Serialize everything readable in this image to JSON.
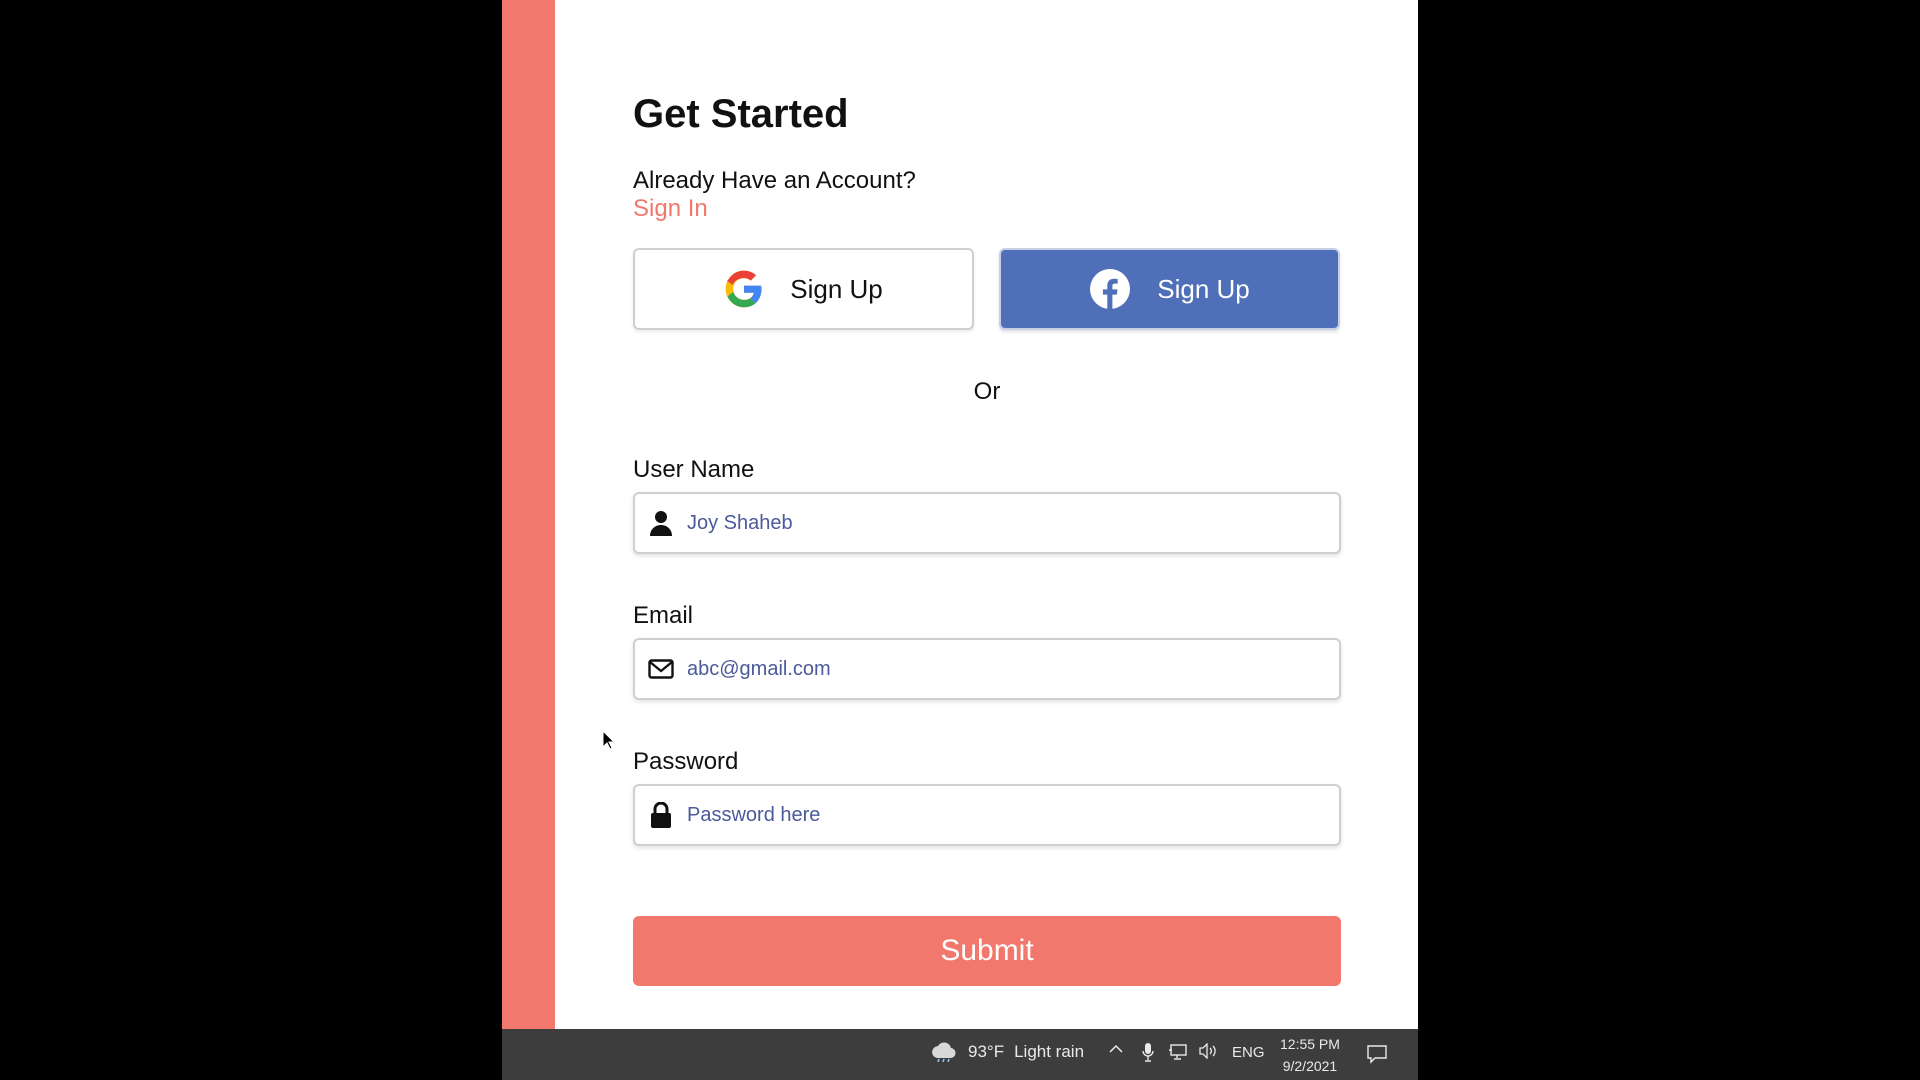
{
  "form": {
    "title": "Get Started",
    "already_text": "Already Have an Account?",
    "signin_link": "Sign In",
    "google_button": {
      "label": "Sign Up",
      "icon": "google-icon"
    },
    "facebook_button": {
      "label": "Sign Up",
      "icon": "facebook-icon"
    },
    "or_text": "Or",
    "fields": {
      "username": {
        "label": "User Name",
        "value": "Joy Shaheb",
        "icon": "user-icon"
      },
      "email": {
        "label": "Email",
        "value": "abc@gmail.com",
        "icon": "envelope-icon"
      },
      "password": {
        "label": "Password",
        "placeholder": "Password here",
        "icon": "lock-icon"
      }
    },
    "submit_label": "Submit"
  },
  "taskbar": {
    "weather_temp": "93°F",
    "weather_desc": "Light rain",
    "language": "ENG",
    "time": "12:55 PM",
    "date": "9/2/2021"
  },
  "colors": {
    "accent": "#f2776c",
    "facebook": "#4f6fb8",
    "input_text": "#4a5a9a",
    "taskbar": "#3d3d3d"
  }
}
